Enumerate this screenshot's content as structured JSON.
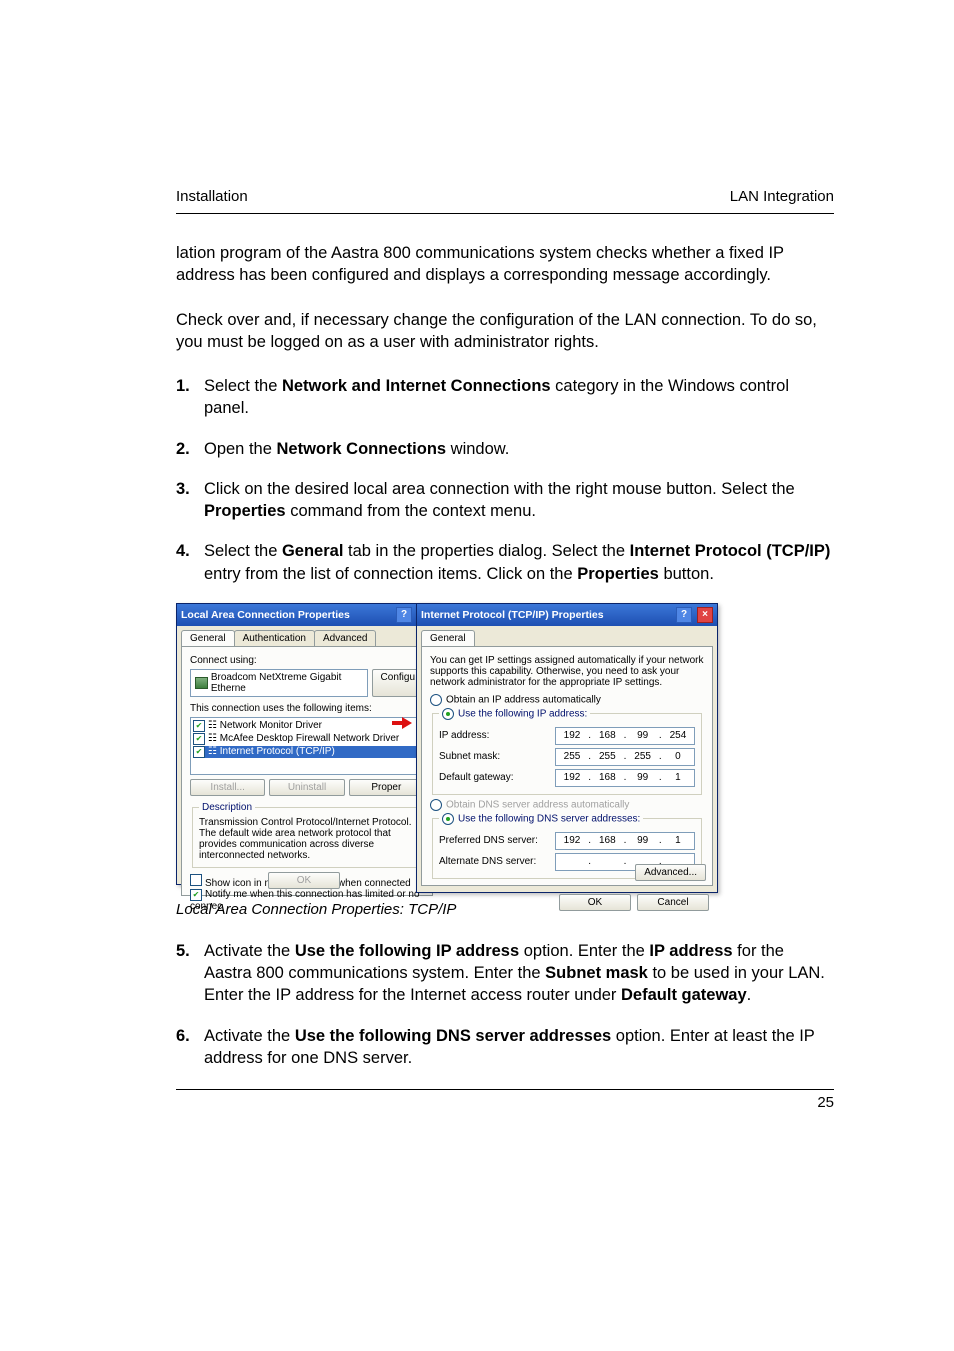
{
  "header": {
    "left": "Installation",
    "right": "LAN Integration"
  },
  "para1": "lation program of the Aastra 800 communications system checks whether a fixed IP address has been configured and displays a corresponding message accordingly.",
  "para2": "Check over and, if necessary change the configuration of the LAN connection. To do so, you must be logged on as a user with administrator rights.",
  "steps_a": [
    {
      "num": "1.",
      "pre": "Select the ",
      "b1": "Network and Internet Connections",
      "post": " category in the Windows control panel."
    },
    {
      "num": "2.",
      "pre": "Open the ",
      "b1": "Network Connections",
      "post": " window."
    },
    {
      "num": "3.",
      "pre": "Click on the desired local area connection with the right mouse button. Select the ",
      "b1": "Properties",
      "post": " command from the context menu."
    },
    {
      "num": "4.",
      "pre": "Select the ",
      "b1": "General",
      "mid1": " tab in the properties dialog. Select the ",
      "b2": "Internet Protocol (TCP/IP)",
      "mid2": " entry from the list of connection items. Click on the ",
      "b3": "Properties",
      "post": " button."
    }
  ],
  "caption": "Local Area Connection Properties: TCP/IP",
  "steps_b": [
    {
      "num": "5.",
      "pre": "Activate the ",
      "b1": "Use the following IP address",
      "mid1": " option. Enter the ",
      "b2": "IP address",
      "mid2": " for the Aastra 800 communications system. Enter the ",
      "b3": "Subnet mask",
      "mid3": " to be used in your LAN. Enter the IP address for the Internet access router under ",
      "b4": "Default gateway",
      "post": "."
    },
    {
      "num": "6.",
      "pre": "Activate the ",
      "b1": "Use the following DNS server addresses",
      "post": " option. Enter at least the IP address for one DNS server."
    }
  ],
  "page_number": "25",
  "winA": {
    "title": "Local Area Connection Properties",
    "tabs": [
      "General",
      "Authentication",
      "Advanced"
    ],
    "connect_using_label": "Connect using:",
    "adapter": "Broadcom NetXtreme Gigabit Etherne",
    "configure_btn": "Configu",
    "items_label": "This connection uses the following items:",
    "items": [
      "Network Monitor Driver",
      "McAfee Desktop Firewall Network Driver",
      "Internet Protocol (TCP/IP)"
    ],
    "install_btn": "Install...",
    "uninstall_btn": "Uninstall",
    "properties_btn": "Proper",
    "desc_title": "Description",
    "desc_text": "Transmission Control Protocol/Internet Protocol. The default wide area network protocol that provides communication across diverse interconnected networks.",
    "show_icon": "Show icon in notification area when connected",
    "notify": "Notify me when this connection has limited or no connec",
    "ok": "OK"
  },
  "winB": {
    "title": "Internet Protocol (TCP/IP) Properties",
    "tab": "General",
    "intro": "You can get IP settings assigned automatically if your network supports this capability. Otherwise, you need to ask your network administrator for the appropriate IP settings.",
    "r1": "Obtain an IP address automatically",
    "r2": "Use the following IP address:",
    "ip_label": "IP address:",
    "subnet_label": "Subnet mask:",
    "gateway_label": "Default gateway:",
    "r3": "Obtain DNS server address automatically",
    "r4": "Use the following DNS server addresses:",
    "pref_dns": "Preferred DNS server:",
    "alt_dns": "Alternate DNS server:",
    "advanced": "Advanced...",
    "ok": "OK",
    "cancel": "Cancel",
    "ip": [
      "192",
      "168",
      "99",
      "254"
    ],
    "subnet": [
      "255",
      "255",
      "255",
      "0"
    ],
    "gateway": [
      "192",
      "168",
      "99",
      "1"
    ],
    "dns1": [
      "192",
      "168",
      "99",
      "1"
    ],
    "dns2": [
      "",
      "",
      "",
      ""
    ]
  }
}
